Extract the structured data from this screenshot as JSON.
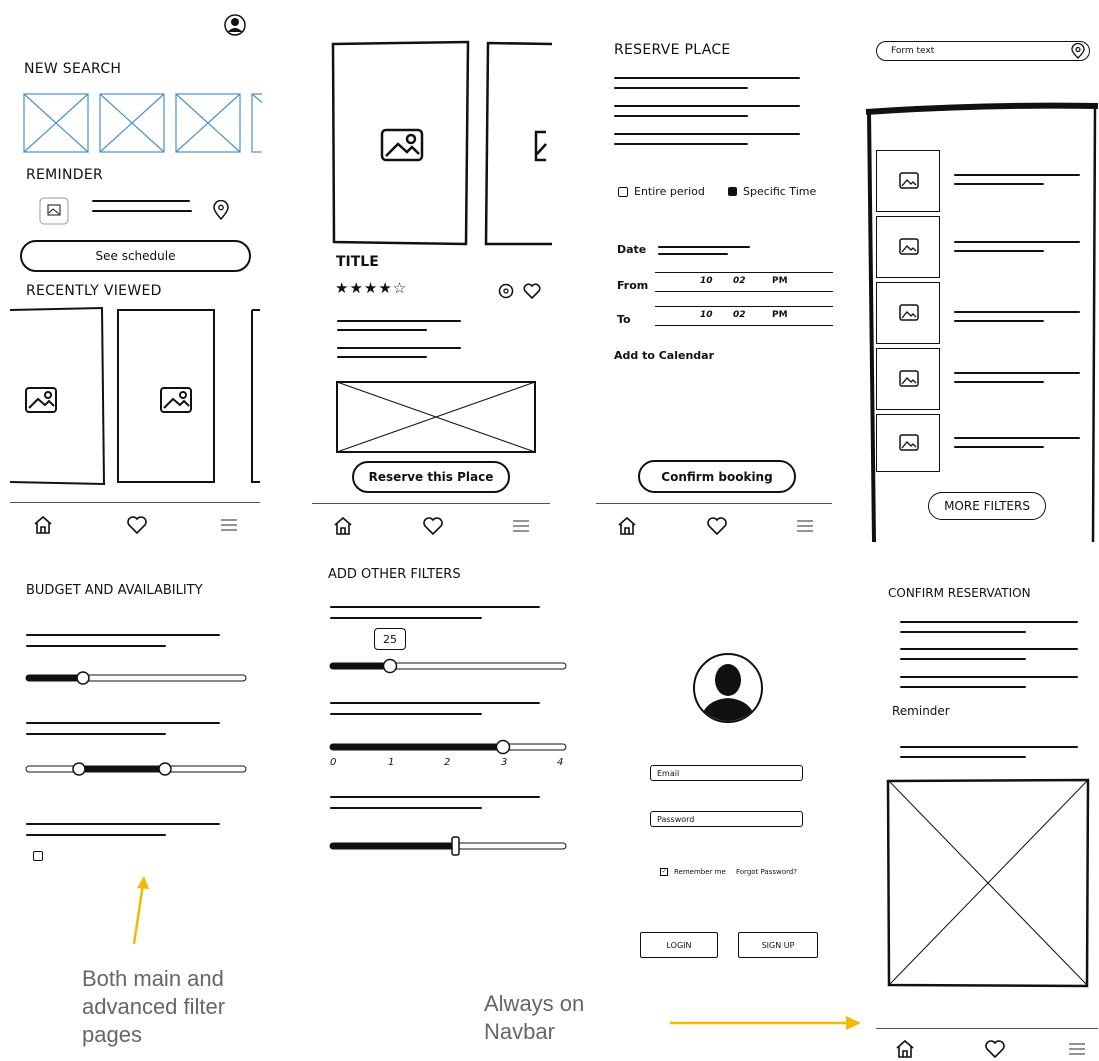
{
  "screen1": {
    "new_search": "NEW SEARCH",
    "reminder": "REMINDER",
    "see_schedule": "See schedule",
    "recently_viewed": "RECENTLY VIEWED"
  },
  "screen2": {
    "title": "TITLE",
    "rating": 4,
    "reserve_button": "Reserve this Place"
  },
  "screen3": {
    "heading": "RESERVE PLACE",
    "entire_period": "Entire period",
    "specific_time": "Specific Time",
    "date_label": "Date",
    "from_label": "From",
    "to_label": "To",
    "from_time": {
      "h": "10",
      "m": "02",
      "ap": "PM"
    },
    "to_time": {
      "h": "10",
      "m": "02",
      "ap": "PM"
    },
    "add_to_calendar": "Add to Calendar",
    "confirm_button": "Confirm booking"
  },
  "screen4": {
    "form_text": "Form text",
    "more_filters": "MORE FILTERS"
  },
  "screen5": {
    "heading": "BUDGET AND AVAILABILITY"
  },
  "screen6": {
    "heading": "ADD OTHER FILTERS",
    "slider_value": "25",
    "scale": [
      "0",
      "1",
      "2",
      "3",
      "4"
    ]
  },
  "screen7": {
    "email": "Email",
    "password": "Password",
    "remember_me": "Remember me",
    "forgot_password": "Forgot Password?",
    "login": "LOGIN",
    "signup": "SIGN UP"
  },
  "screen8": {
    "heading": "CONFIRM RESERVATION",
    "reminder": "Reminder"
  },
  "annotations": {
    "filters_note": "Both main and advanced filter pages",
    "navbar_note": "Always on Navbar"
  },
  "colors": {
    "ink": "#111111",
    "placeholder_blue": "#4a8fd1",
    "arrow_yellow": "#f5b800",
    "annotation_gray": "#666666"
  }
}
